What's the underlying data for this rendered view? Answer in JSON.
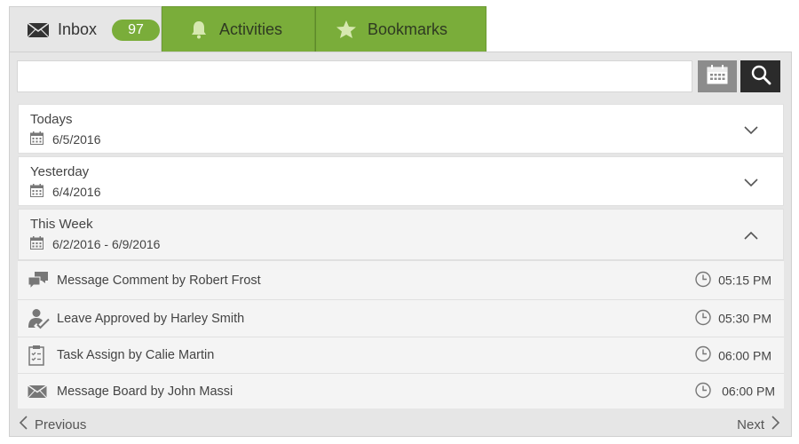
{
  "tabs": {
    "inbox": {
      "label": "Inbox",
      "badge": "97",
      "icon": "envelope-icon"
    },
    "activities": {
      "label": "Activities",
      "icon": "bell-icon"
    },
    "bookmarks": {
      "label": "Bookmarks",
      "icon": "star-icon"
    }
  },
  "search": {
    "value": "",
    "placeholder": ""
  },
  "groups": [
    {
      "title": "Todays",
      "date": "6/5/2016",
      "expanded": false
    },
    {
      "title": "Yesterday",
      "date": "6/4/2016",
      "expanded": false
    },
    {
      "title": "This Week",
      "date": "6/2/2016 - 6/9/2016",
      "expanded": true
    }
  ],
  "items": [
    {
      "icon": "comment-icon",
      "text": "Message Comment by Robert Frost",
      "time": "05:15 PM"
    },
    {
      "icon": "user-check-icon",
      "text": "Leave Approved by Harley Smith",
      "time": "05:30 PM"
    },
    {
      "icon": "clipboard-icon",
      "text": "Task Assign by Calie Martin",
      "time": "06:00 PM"
    },
    {
      "icon": "envelope-icon",
      "text": "Message Board by John Massi",
      "time": "06:00 PM"
    }
  ],
  "pagination": {
    "prev": "Previous",
    "next": "Next"
  },
  "colors": {
    "accent": "#7aad3a",
    "panel": "#e6e6e6",
    "search_button": "#2b2b2b",
    "calendar_button": "#8c8c8c"
  }
}
